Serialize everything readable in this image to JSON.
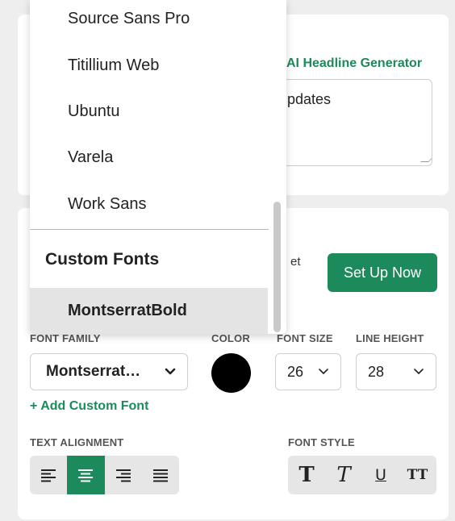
{
  "headline": {
    "ai_link": "AI Headline Generator",
    "textarea_value": "pdates"
  },
  "promo": {
    "text": "et",
    "button_label": "Set Up Now"
  },
  "typography": {
    "font_family_label": "FONT FAMILY",
    "font_family_value": "Montserrat…",
    "color_label": "COLOR",
    "color_value": "#000000",
    "font_size_label": "FONT SIZE",
    "font_size_value": "26",
    "line_height_label": "LINE HEIGHT",
    "line_height_value": "28",
    "add_custom_font": "+ Add Custom Font",
    "text_alignment_label": "TEXT ALIGNMENT",
    "font_style_label": "FONT STYLE",
    "alignment_options": [
      "left",
      "center",
      "right",
      "justify"
    ],
    "alignment_active": "center",
    "style_options": [
      {
        "icon": "bold-icon",
        "glyph": "T"
      },
      {
        "icon": "italic-icon",
        "glyph": "T"
      },
      {
        "icon": "underline-icon",
        "glyph": "U"
      },
      {
        "icon": "uppercase-icon",
        "glyph": "TT"
      }
    ]
  },
  "dropdown": {
    "items": [
      "Source Sans Pro",
      "Titillium Web",
      "Ubuntu",
      "Varela",
      "Work Sans"
    ],
    "group_label": "Custom Fonts",
    "selected_item": "MontserratBold"
  },
  "colors": {
    "accent": "#1d8a5b",
    "background": "#eeeeee",
    "selected_row": "#e4e4e4"
  }
}
